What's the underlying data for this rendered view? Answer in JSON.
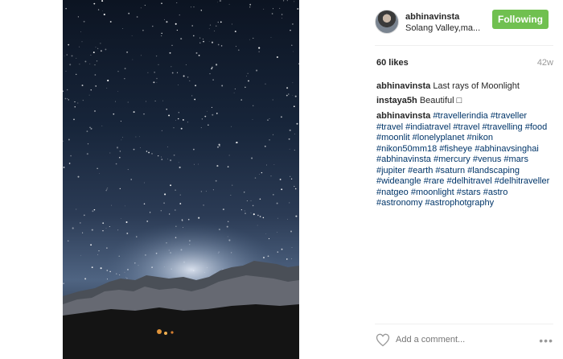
{
  "post": {
    "username": "abhinavinsta",
    "location": "Solang Valley,ma...",
    "follow_label": "Following",
    "likes": "60 likes",
    "age": "42w"
  },
  "comments": [
    {
      "author": "abhinavinsta",
      "text": "Last rays of Moonlight"
    },
    {
      "author": "instaya5h",
      "text": "Beautiful □"
    }
  ],
  "hashtags": {
    "author": "abhinavinsta",
    "tags": [
      "#travellerindia",
      "#traveller",
      "#travel",
      "#indiatravel",
      "#travel",
      "#travelling",
      "#food",
      "#moonlit",
      "#lonelyplanet",
      "#nikon",
      "#nikon50mm18",
      "#fisheye",
      "#abhinavsinghai",
      "#abhinavinsta",
      "#mercury",
      "#venus",
      "#mars",
      "#jupiter",
      "#earth",
      "#saturn",
      "#landscaping",
      "#wideangle",
      "#rare",
      "#delhitravel",
      "#delhitraveller",
      "#natgeo",
      "#moonlight",
      "#stars",
      "#astro",
      "#astronomy",
      "#astrophotgraphy"
    ]
  },
  "footer": {
    "comment_placeholder": "Add a comment...",
    "more": "•••"
  },
  "icons": {
    "like": "heart-icon",
    "more": "more-options-icon"
  },
  "colors": {
    "following_button": "#70c050",
    "hashtag_link": "#003569",
    "muted_text": "#999999"
  }
}
